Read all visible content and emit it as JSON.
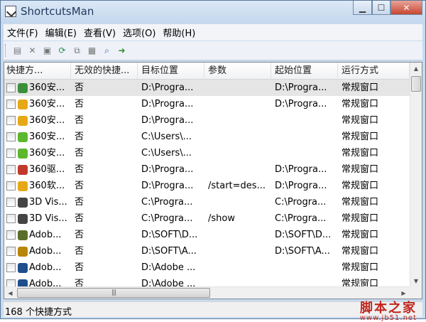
{
  "window": {
    "title": "ShortcutsMan"
  },
  "menu": [
    "文件(F)",
    "编辑(E)",
    "查看(V)",
    "选项(O)",
    "帮助(H)"
  ],
  "columns": [
    "快捷方...",
    "无效的快捷...",
    "目标位置",
    "参数",
    "起始位置",
    "运行方式"
  ],
  "rows": [
    {
      "name": "360安...",
      "invalid": "否",
      "target": "D:\\Progra...",
      "args": "",
      "start": "D:\\Progra...",
      "run": "常规窗口",
      "icon": "shield-icon",
      "color": "#3b8f3b"
    },
    {
      "name": "360安...",
      "invalid": "否",
      "target": "D:\\Progra...",
      "args": "",
      "start": "D:\\Progra...",
      "run": "常规窗口",
      "icon": "plus-icon",
      "color": "#e6a817"
    },
    {
      "name": "360安...",
      "invalid": "否",
      "target": "D:\\Progra...",
      "args": "",
      "start": "",
      "run": "常规窗口",
      "icon": "plus-icon",
      "color": "#e6a817"
    },
    {
      "name": "360安...",
      "invalid": "否",
      "target": "C:\\Users\\...",
      "args": "",
      "start": "",
      "run": "常规窗口",
      "icon": "e-icon",
      "color": "#5cb82e"
    },
    {
      "name": "360安...",
      "invalid": "否",
      "target": "C:\\Users\\...",
      "args": "",
      "start": "",
      "run": "常规窗口",
      "icon": "e-icon",
      "color": "#5cb82e"
    },
    {
      "name": "360驱...",
      "invalid": "否",
      "target": "D:\\Progra...",
      "args": "",
      "start": "D:\\Progra...",
      "run": "常规窗口",
      "icon": "driver-icon",
      "color": "#c0392b"
    },
    {
      "name": "360软...",
      "invalid": "否",
      "target": "D:\\Progra...",
      "args": "/start=des...",
      "start": "D:\\Progra...",
      "run": "常规窗口",
      "icon": "plus-icon",
      "color": "#e6a817"
    },
    {
      "name": "3D Vis...",
      "invalid": "否",
      "target": "C:\\Progra...",
      "args": "",
      "start": "C:\\Progra...",
      "run": "常规窗口",
      "icon": "3d-icon",
      "color": "#444444"
    },
    {
      "name": "3D Vis...",
      "invalid": "否",
      "target": "C:\\Progra...",
      "args": "/show",
      "start": "C:\\Progra...",
      "run": "常规窗口",
      "icon": "3d-icon",
      "color": "#444444"
    },
    {
      "name": "Adob...",
      "invalid": "否",
      "target": "D:\\SOFT\\D...",
      "args": "",
      "start": "D:\\SOFT\\D...",
      "run": "常规窗口",
      "icon": "adobe-dw-icon",
      "color": "#5a6e2a"
    },
    {
      "name": "Adob...",
      "invalid": "否",
      "target": "D:\\SOFT\\A...",
      "args": "",
      "start": "D:\\SOFT\\A...",
      "run": "常规窗口",
      "icon": "adobe-ai-icon",
      "color": "#b8860b"
    },
    {
      "name": "Adob...",
      "invalid": "否",
      "target": "D:\\Adobe ...",
      "args": "",
      "start": "",
      "run": "常规窗口",
      "icon": "adobe-ps-icon",
      "color": "#1f4e8c"
    },
    {
      "name": "Adob...",
      "invalid": "否",
      "target": "D:\\Adobe ...",
      "args": "",
      "start": "",
      "run": "常规窗口",
      "icon": "adobe-ps-icon",
      "color": "#1f4e8c"
    }
  ],
  "status": {
    "text": "168 个快捷方式"
  },
  "watermark": {
    "main": "脚本之家",
    "sub": "www.jb51.net"
  }
}
